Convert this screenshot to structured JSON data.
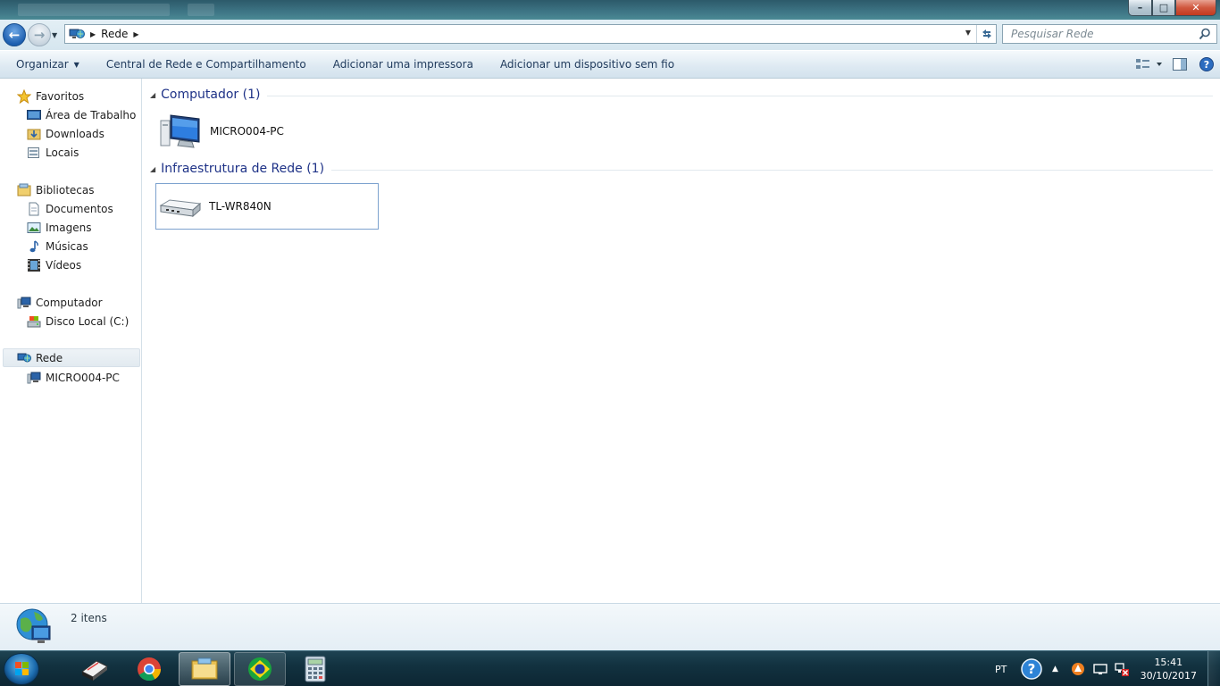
{
  "window": {
    "min_label": "–",
    "max_label": "□",
    "close_label": "✕"
  },
  "address": {
    "back_label": "←",
    "forward_label": "→",
    "breadcrumb": "Rede",
    "search_placeholder": "Pesquisar Rede"
  },
  "toolbar": {
    "organize": "Organizar",
    "network_center": "Central de Rede e Compartilhamento",
    "add_printer": "Adicionar uma impressora",
    "add_wireless": "Adicionar um dispositivo sem fio"
  },
  "sidebar": {
    "favorites": {
      "label": "Favoritos",
      "items": [
        "Área de Trabalho",
        "Downloads",
        "Locais"
      ]
    },
    "libraries": {
      "label": "Bibliotecas",
      "items": [
        "Documentos",
        "Imagens",
        "Músicas",
        "Vídeos"
      ]
    },
    "computer": {
      "label": "Computador",
      "items": [
        "Disco Local (C:)"
      ]
    },
    "network": {
      "label": "Rede",
      "items": [
        "MICRO004-PC"
      ]
    }
  },
  "content": {
    "groups": [
      {
        "title": "Computador (1)",
        "items": [
          "MICRO004-PC"
        ]
      },
      {
        "title": "Infraestrutura de Rede (1)",
        "items": [
          "TL-WR840N"
        ]
      }
    ]
  },
  "status": {
    "count": "2 itens"
  },
  "taskbar": {
    "lang": "PT",
    "time": "15:41",
    "date": "30/10/2017"
  },
  "colors": {
    "group_title": "#1e3287",
    "command_text": "#1e395b",
    "taskbar": "#123240"
  }
}
